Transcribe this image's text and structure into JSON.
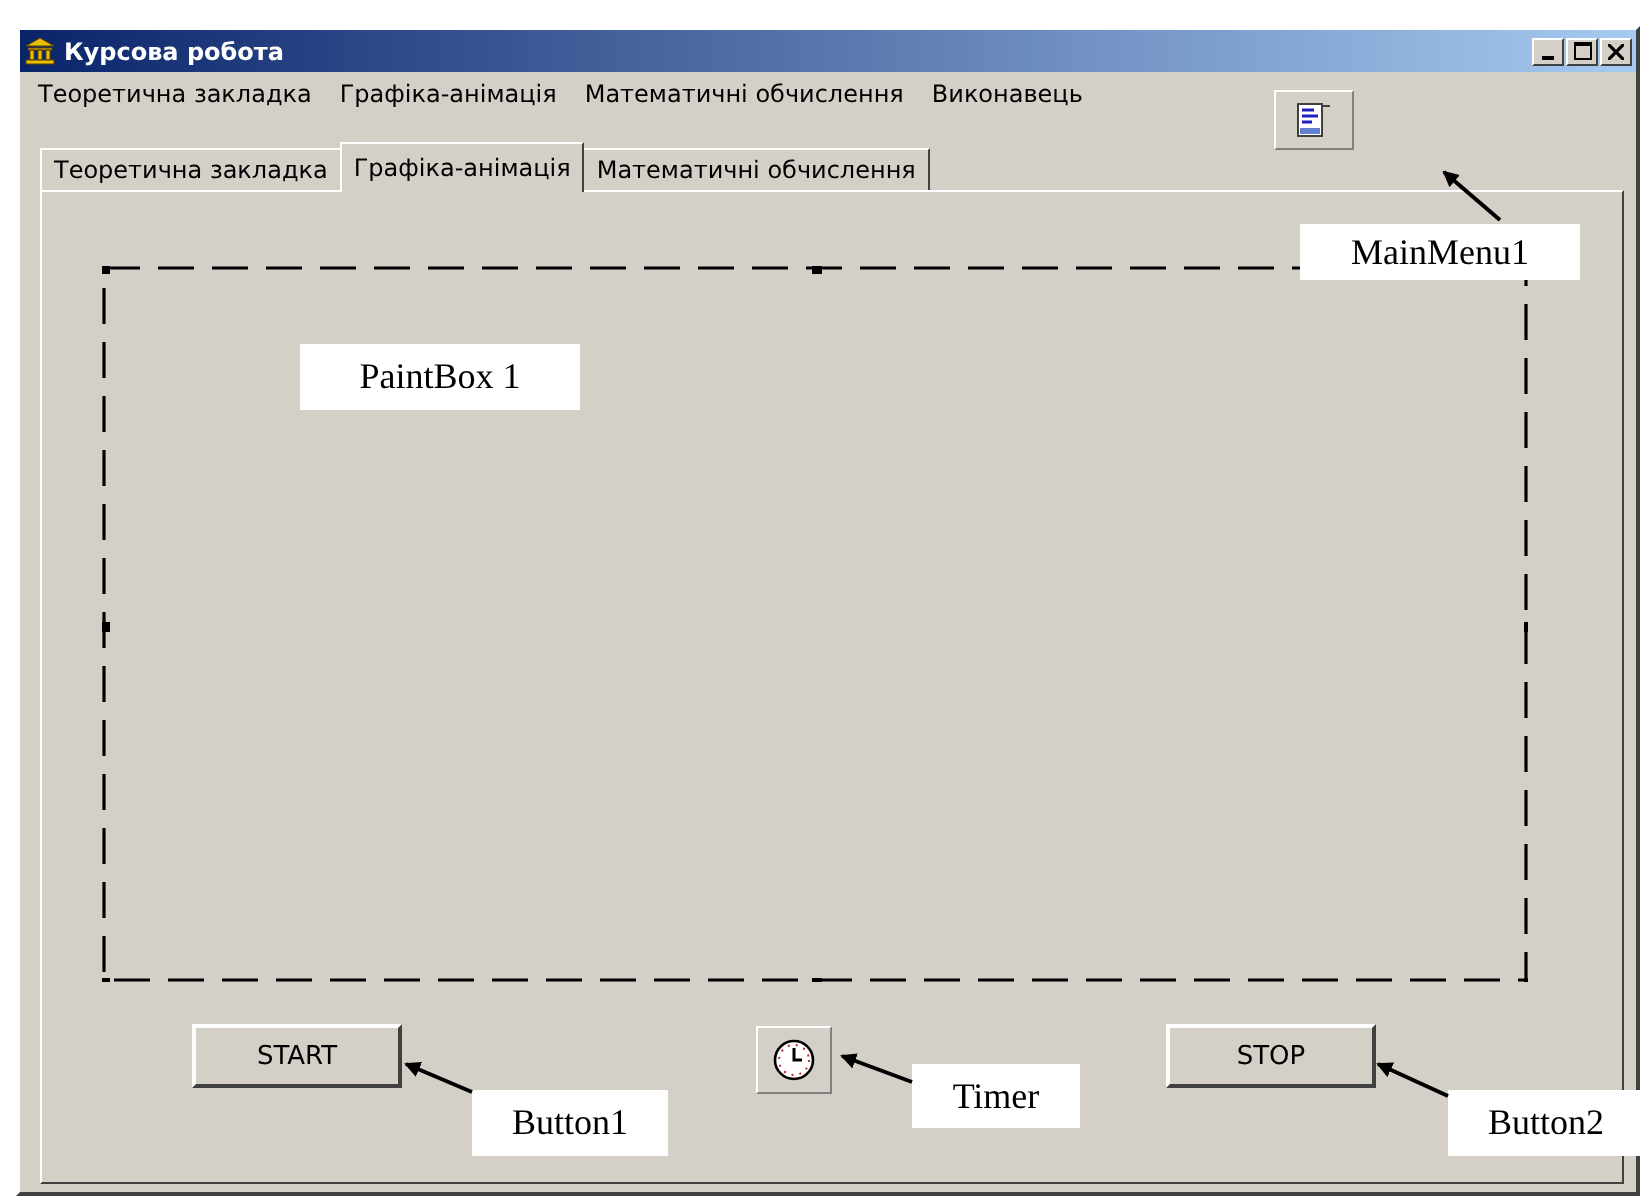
{
  "window": {
    "title": "Курсова робота"
  },
  "menu": [
    "Теоретична закладка",
    "Графіка-анімація",
    "Математичні обчислення",
    "Виконавець"
  ],
  "tabs": [
    {
      "label": "Теоретична закладка",
      "selected": false
    },
    {
      "label": "Графіка-анімація",
      "selected": true
    },
    {
      "label": "Математичні обчислення",
      "selected": false
    }
  ],
  "buttons": [
    "START",
    "STOP"
  ],
  "annotations": [
    {
      "label": "MainMenu1",
      "kind": "mainmenu"
    },
    {
      "label": "PaintBox 1",
      "kind": "paintbox"
    },
    {
      "label": "Button1",
      "kind": "button1"
    },
    {
      "label": "Timer",
      "kind": "timer"
    },
    {
      "label": "Button2",
      "kind": "button2"
    }
  ]
}
